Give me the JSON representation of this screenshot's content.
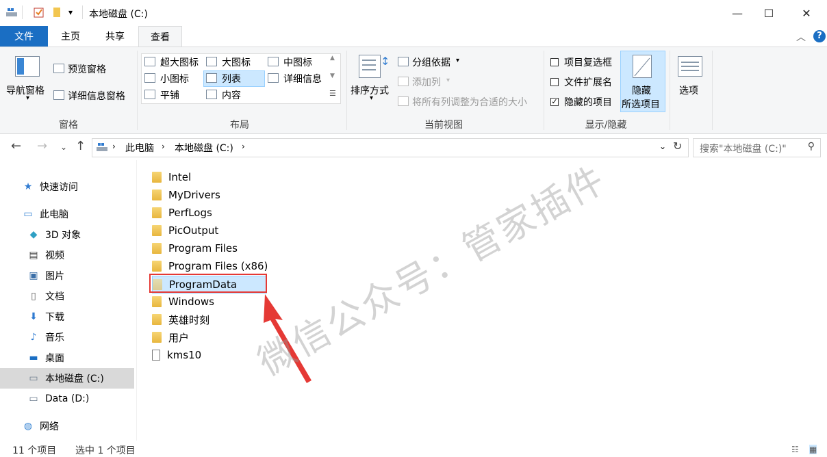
{
  "window": {
    "title": "本地磁盘 (C:)",
    "minimize": "—",
    "maximize": "☐",
    "close": "✕"
  },
  "ribbon_tabs": [
    "文件",
    "主页",
    "共享",
    "查看"
  ],
  "ribbon": {
    "panes": {
      "nav_pane": "导航窗格",
      "preview_pane": "预览窗格",
      "details_pane": "详细信息窗格",
      "group": "窗格"
    },
    "layout": {
      "items": [
        "超大图标",
        "大图标",
        "中图标",
        "小图标",
        "列表",
        "详细信息",
        "平铺",
        "内容"
      ],
      "selected": "列表",
      "group": "布局"
    },
    "current_view": {
      "sort": "排序方式",
      "group_by": "分组依据",
      "add_column": "添加列",
      "fit_columns": "将所有列调整为合适的大小",
      "group": "当前视图"
    },
    "show_hide": {
      "item_checkboxes": {
        "label": "项目复选框",
        "checked": false
      },
      "file_extensions": {
        "label": "文件扩展名",
        "checked": false
      },
      "hidden_items": {
        "label": "隐藏的项目",
        "checked": true
      },
      "hide_selected_line1": "隐藏",
      "hide_selected_line2": "所选项目",
      "group": "显示/隐藏"
    },
    "options": "选项"
  },
  "address": {
    "path": [
      "此电脑",
      "本地磁盘 (C:)"
    ],
    "search_placeholder": "搜索\"本地磁盘 (C:)\""
  },
  "sidebar": [
    {
      "label": "快速访问",
      "icon": "star-icon"
    },
    {
      "label": "此电脑",
      "icon": "computer-icon"
    },
    {
      "label": "3D 对象",
      "icon": "cube-icon"
    },
    {
      "label": "视频",
      "icon": "film-icon"
    },
    {
      "label": "图片",
      "icon": "picture-icon"
    },
    {
      "label": "文档",
      "icon": "document-icon"
    },
    {
      "label": "下载",
      "icon": "download-icon"
    },
    {
      "label": "音乐",
      "icon": "music-icon"
    },
    {
      "label": "桌面",
      "icon": "desktop-icon"
    },
    {
      "label": "本地磁盘 (C:)",
      "icon": "drive-icon"
    },
    {
      "label": "Data (D:)",
      "icon": "drive-icon"
    },
    {
      "label": "网络",
      "icon": "network-icon"
    }
  ],
  "files": [
    {
      "name": "Intel",
      "type": "folder"
    },
    {
      "name": "MyDrivers",
      "type": "folder"
    },
    {
      "name": "PerfLogs",
      "type": "folder"
    },
    {
      "name": "PicOutput",
      "type": "folder"
    },
    {
      "name": "Program Files",
      "type": "folder"
    },
    {
      "name": "Program Files (x86)",
      "type": "folder"
    },
    {
      "name": "ProgramData",
      "type": "folder",
      "selected": true
    },
    {
      "name": "Windows",
      "type": "folder"
    },
    {
      "name": "英雄时刻",
      "type": "folder"
    },
    {
      "name": "用户",
      "type": "folder"
    },
    {
      "name": "kms10",
      "type": "file"
    }
  ],
  "status": {
    "count": "11 个项目",
    "selected": "选中 1 个项目"
  },
  "watermark": "微信公众号：管家插件",
  "colors": {
    "accent": "#1a6ec3",
    "selection": "#cce8ff",
    "highlight_box": "#e53935"
  }
}
